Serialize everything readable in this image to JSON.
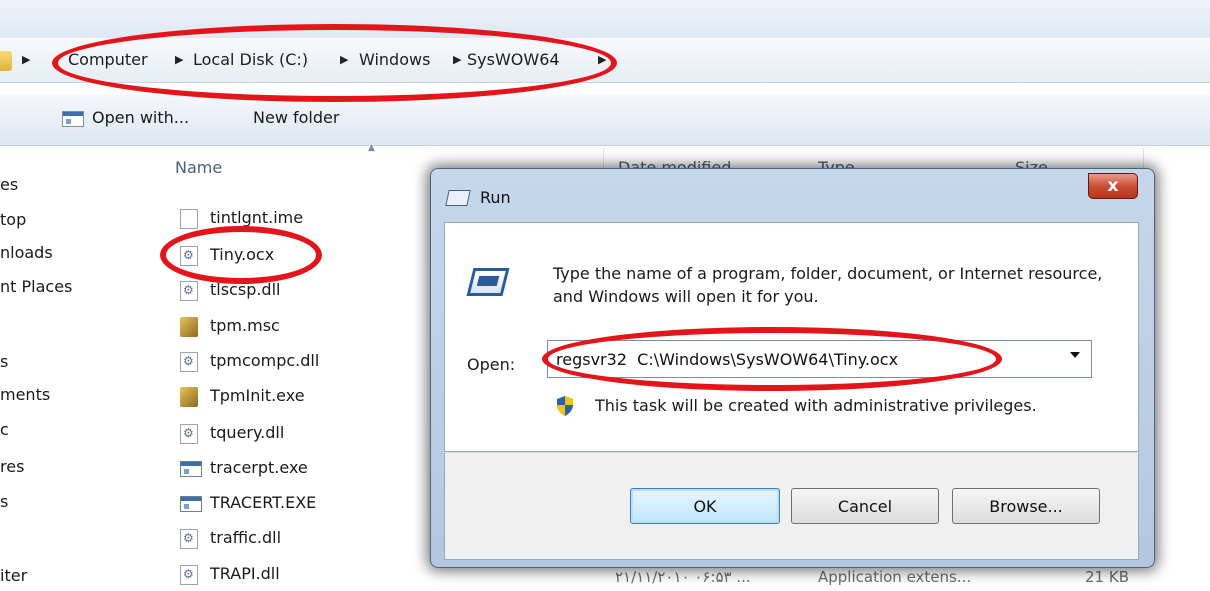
{
  "breadcrumb": {
    "items": [
      "Computer",
      "Local Disk (C:)",
      "Windows",
      "SysWOW64"
    ]
  },
  "toolbar": {
    "open_with_label": "Open with...",
    "new_folder_label": "New folder"
  },
  "nav_pane": {
    "items": [
      "es",
      "top",
      "nloads",
      "nt Places",
      "s",
      "ments",
      "c",
      "res",
      "s",
      "iter"
    ]
  },
  "file_list": {
    "columns": [
      "Name",
      "Date modified",
      "Type",
      "Size"
    ],
    "files": [
      {
        "name": "tintlgnt.ime",
        "icon": "document-icon"
      },
      {
        "name": "Tiny.ocx",
        "icon": "dll-icon"
      },
      {
        "name": "tlscsp.dll",
        "icon": "dll-icon"
      },
      {
        "name": "tpm.msc",
        "icon": "msc-icon"
      },
      {
        "name": "tpmcompc.dll",
        "icon": "dll-icon"
      },
      {
        "name": "TpmInit.exe",
        "icon": "msc-icon"
      },
      {
        "name": "tquery.dll",
        "icon": "dll-icon"
      },
      {
        "name": "tracerpt.exe",
        "icon": "exe-icon"
      },
      {
        "name": "TRACERT.EXE",
        "icon": "exe-icon"
      },
      {
        "name": "traffic.dll",
        "icon": "dll-icon"
      },
      {
        "name": "TRAPI.dll",
        "icon": "dll-icon"
      }
    ],
    "last_row": {
      "date": "۲۱/۱۱/۲۰۱۰ ۰۶:۵۳ ...",
      "type": "Application extens...",
      "size": "21 KB"
    }
  },
  "run_dialog": {
    "title": "Run",
    "close_label": "x",
    "prompt": "Type the name of a program, folder, document, or Internet resource, and Windows will open it for you.",
    "open_label": "Open:",
    "command": "regsvr32  C:\\Windows\\SysWOW64\\Tiny.ocx",
    "admin_note": "This task will be created with administrative privileges.",
    "buttons": {
      "ok": "OK",
      "cancel": "Cancel",
      "browse": "Browse..."
    }
  },
  "colors": {
    "annotation_red": "#e4141b",
    "close_button": "#c94a32",
    "dialog_frame": "#b3c8e0"
  }
}
